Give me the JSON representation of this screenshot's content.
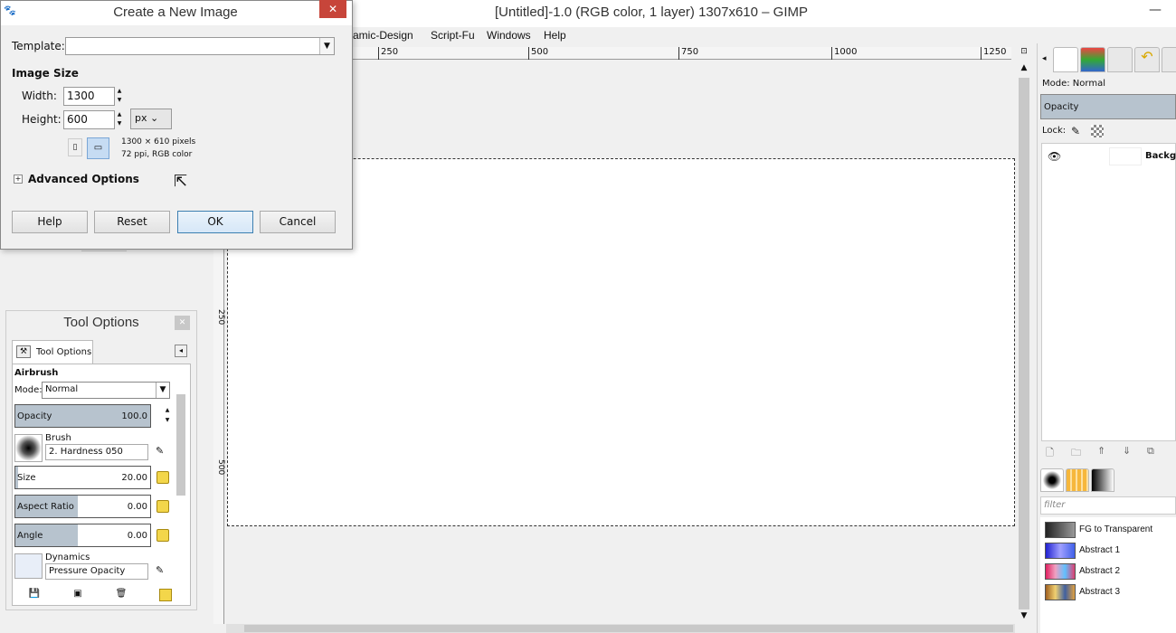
{
  "main_window": {
    "title": "[Untitled]-1.0 (RGB color, 1 layer) 1307x610 – GIMP",
    "minimize_glyph": "—"
  },
  "menubar": {
    "items": [
      {
        "label": "amic-Design"
      },
      {
        "label": "Script-Fu"
      },
      {
        "label": "Windows"
      },
      {
        "label": "Help"
      }
    ]
  },
  "rulers": {
    "horizontal_ticks": [
      "250",
      "500",
      "750",
      "1000",
      "1250"
    ],
    "vertical_ticks": [
      "250",
      "500"
    ]
  },
  "dialog": {
    "title": "Create a New Image",
    "close_glyph": "✕",
    "template_label": "Template:",
    "template_value": "",
    "image_size_heading": "Image Size",
    "width_label": "Width:",
    "width_value": "1300",
    "height_label": "Height:",
    "height_value": "600",
    "unit_value": "px",
    "dims_line1": "1300 × 610 pixels",
    "dims_line2": "72 ppi, RGB color",
    "advanced_label": "Advanced Options",
    "buttons": {
      "help": "Help",
      "reset": "Reset",
      "ok": "OK",
      "cancel": "Cancel"
    }
  },
  "tool_options": {
    "title": "Tool Options",
    "tab_label": "Tool Options",
    "tool_name": "Airbrush",
    "mode_label": "Mode:",
    "mode_value": "Normal",
    "opacity": {
      "label": "Opacity",
      "value": "100.0",
      "fraction": 1.0
    },
    "brush_label": "Brush",
    "brush_value": "2. Hardness 050",
    "size": {
      "label": "Size",
      "value": "20.00",
      "fraction": 0.02
    },
    "aspect_ratio": {
      "label": "Aspect Ratio",
      "value": "0.00",
      "fraction": 0.46
    },
    "angle": {
      "label": "Angle",
      "value": "0.00",
      "fraction": 0.46
    },
    "dynamics_label": "Dynamics",
    "dynamics_value": "Pressure Opacity"
  },
  "layers": {
    "mode_label": "Mode: Normal",
    "opacity_label": "Opacity",
    "lock_label": "Lock:",
    "layer_name": "Backgro"
  },
  "gradients": {
    "filter_placeholder": "filter",
    "items": [
      {
        "label": "FG to Transparent",
        "color": "#444444"
      },
      {
        "label": "Abstract 1",
        "color": "#4060e8"
      },
      {
        "label": "Abstract 2",
        "color": "#e04070"
      },
      {
        "label": "Abstract 3",
        "color": "#e0a040"
      }
    ]
  },
  "colors": {
    "selection_blue": "#b7c3ce",
    "close_red": "#c7453a"
  }
}
